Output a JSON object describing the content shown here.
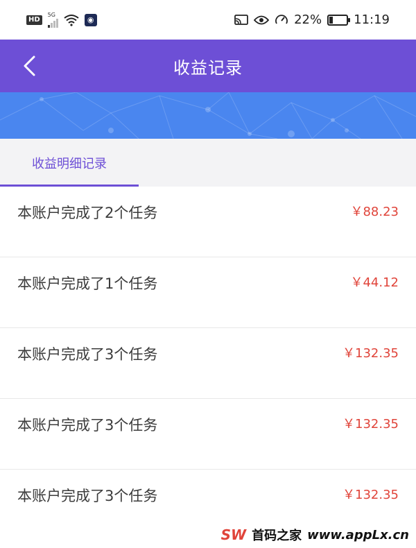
{
  "status_bar": {
    "hd": "HD",
    "network": "5G",
    "battery_percent_text": "22%",
    "battery_level": 0.22,
    "time": "11:19"
  },
  "header": {
    "title": "收益记录",
    "back_icon": "chevron-left-icon"
  },
  "tabs": [
    {
      "label": "收益明细记录",
      "active": true
    }
  ],
  "records": [
    {
      "title": "本账户完成了2个任务",
      "amount": "￥88.23"
    },
    {
      "title": "本账户完成了1个任务",
      "amount": "￥44.12"
    },
    {
      "title": "本账户完成了3个任务",
      "amount": "￥132.35"
    },
    {
      "title": "本账户完成了3个任务",
      "amount": "￥132.35"
    },
    {
      "title": "本账户完成了3个任务",
      "amount": "￥132.35"
    }
  ],
  "watermark": {
    "logo": "SW",
    "text": "首码之家",
    "url": "www.appLx.cn"
  },
  "colors": {
    "header_bg": "#6d4fd6",
    "banner_bg": "#4a86ef",
    "accent": "#6d4fd6",
    "amount": "#e0443a",
    "divider": "#e8e8e8"
  }
}
